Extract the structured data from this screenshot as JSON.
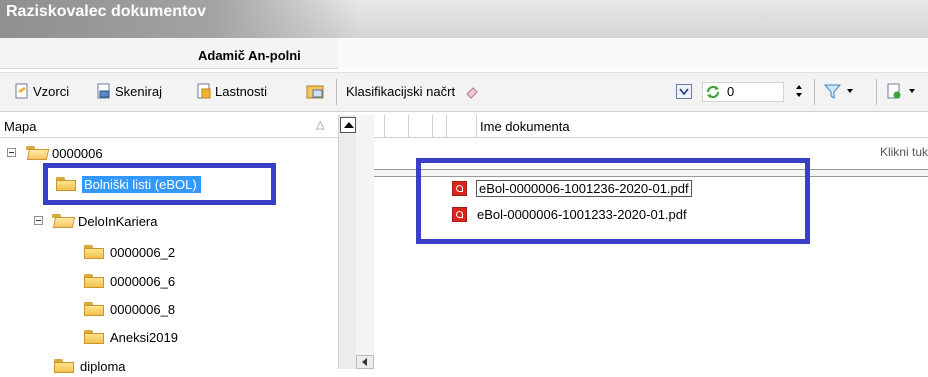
{
  "window": {
    "title": "Raziskovalec dokumentov",
    "subtitle": "Adamič An-polni"
  },
  "toolbar": {
    "vzorci": "Vzorci",
    "skeniraj": "Skeniraj",
    "lastnosti": "Lastnosti",
    "klasifikacija": "Klasifikacijski načrt",
    "counter": "0"
  },
  "tree": {
    "header": "Mapa",
    "items": [
      {
        "label": "0000006"
      },
      {
        "label": "Bolniški listi (eBOL)"
      },
      {
        "label": "DeloInKariera"
      },
      {
        "label": "0000006_2"
      },
      {
        "label": "0000006_6"
      },
      {
        "label": "0000006_8"
      },
      {
        "label": "Aneksi2019"
      },
      {
        "label": "diploma"
      }
    ]
  },
  "documents": {
    "column_name": "Ime dokumenta",
    "hint": "Klikni tuk",
    "rows": [
      {
        "name": "eBol-0000006-1001236-2020-01.pdf"
      },
      {
        "name": "eBol-0000006-1001233-2020-01.pdf"
      }
    ]
  },
  "colors": {
    "highlight": "#3b3fc7",
    "selection": "#3399ff"
  }
}
